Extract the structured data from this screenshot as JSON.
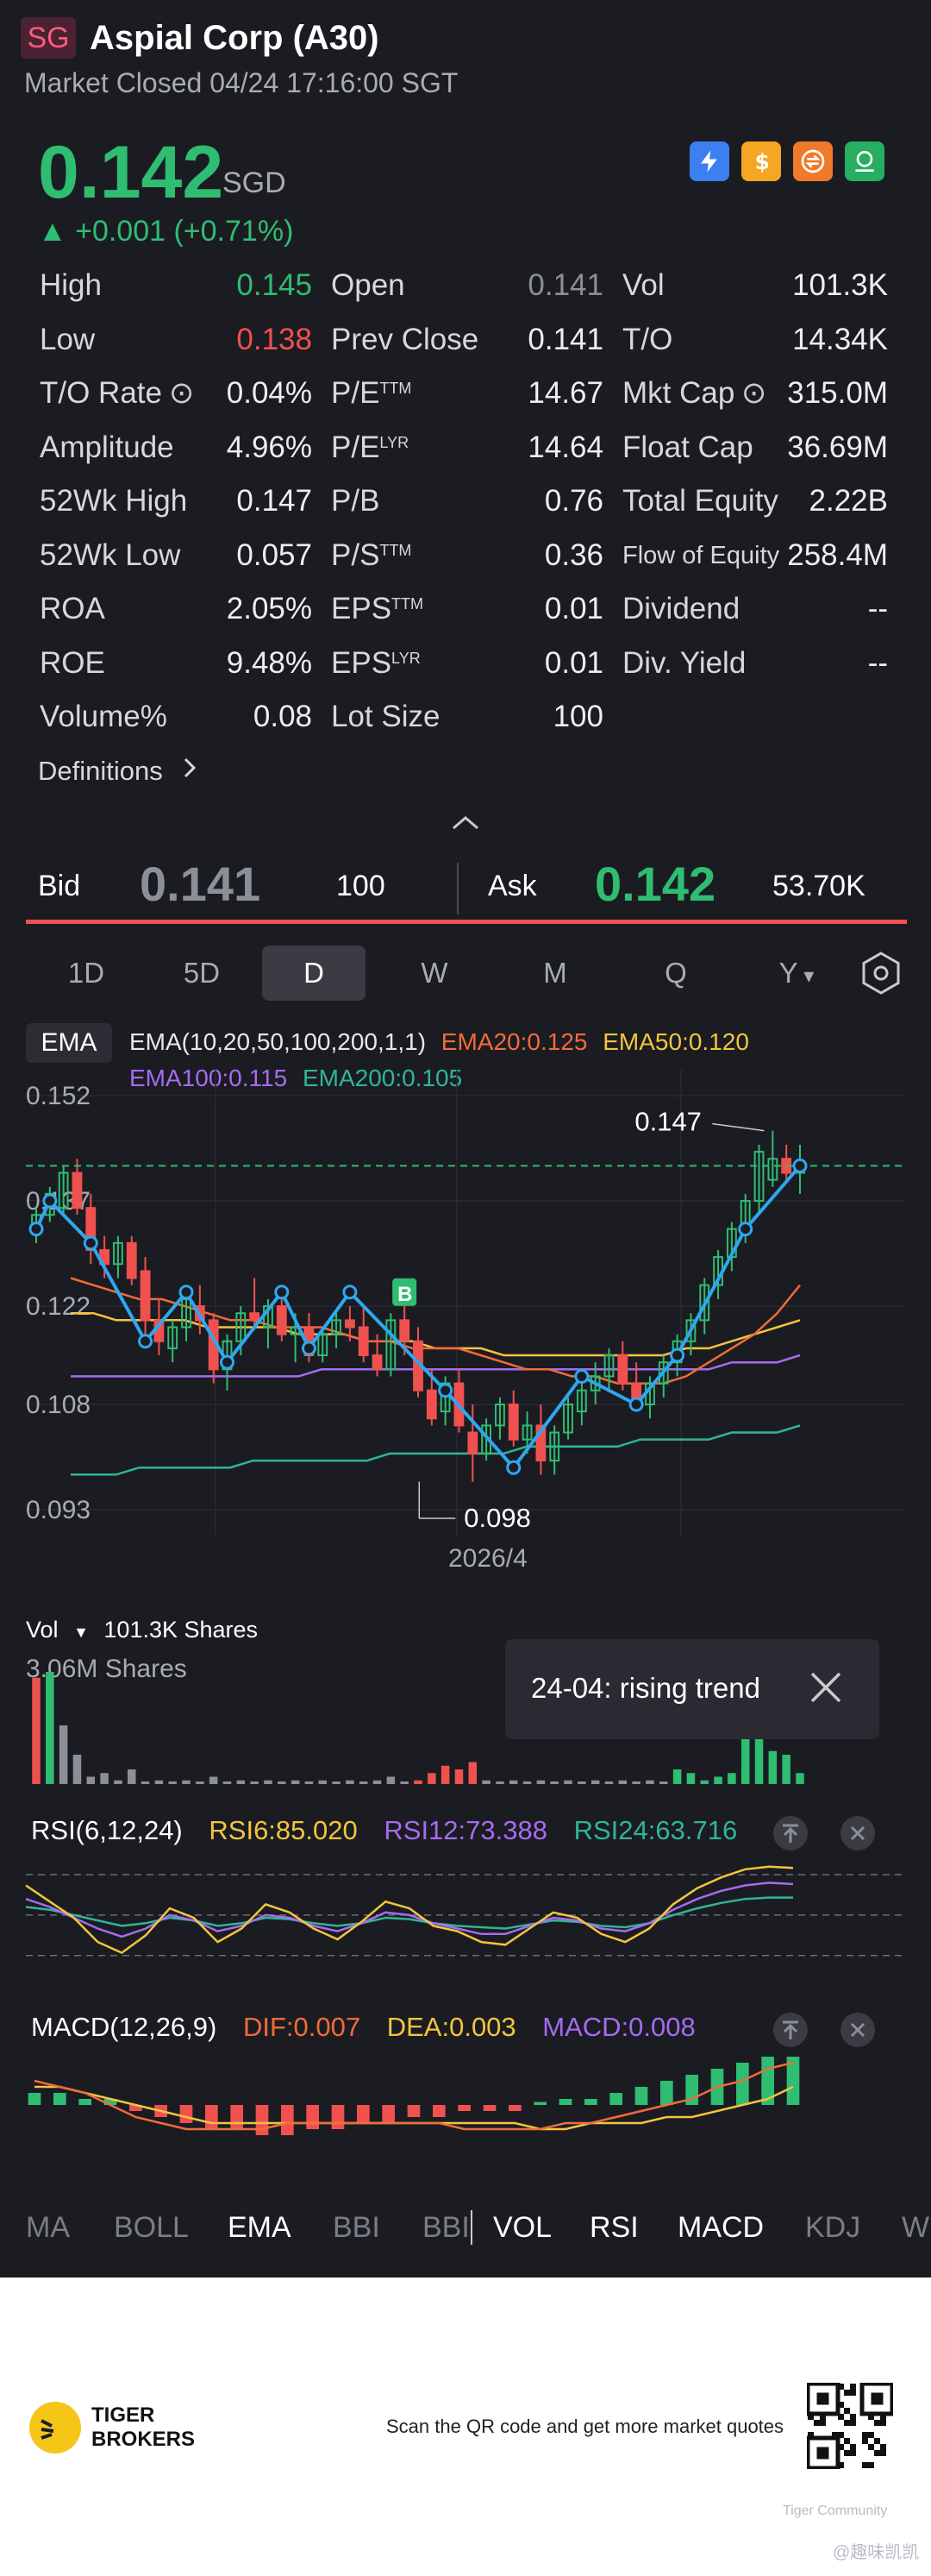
{
  "header": {
    "badge": "SG",
    "title": "Aspial Corp (A30)",
    "status": "Market Closed 04/24 17:16:00 SGT",
    "price": "0.142",
    "currency": "SGD",
    "change": "▲ +0.001 (+0.71%)",
    "icons": [
      "lightning-icon",
      "dollar-icon",
      "swap-icon",
      "exchange-icon"
    ]
  },
  "stats": {
    "col1": [
      {
        "label": "High",
        "value": "0.145",
        "color": "green"
      },
      {
        "label": "Low",
        "value": "0.138",
        "color": "red"
      },
      {
        "label": "T/O Rate",
        "value": "0.04%",
        "color": "white"
      },
      {
        "label": "Amplitude",
        "value": "4.96%",
        "color": "white"
      },
      {
        "label": "52Wk High",
        "value": "0.147",
        "color": "white"
      },
      {
        "label": "52Wk Low",
        "value": "0.057",
        "color": "white"
      },
      {
        "label": "ROA",
        "value": "2.05%",
        "color": "white"
      },
      {
        "label": "ROE",
        "value": "9.48%",
        "color": "white"
      },
      {
        "label": "Volume%",
        "value": "0.08",
        "color": "white"
      }
    ],
    "col2": [
      {
        "label": "Open",
        "sup": "",
        "value": "0.141",
        "color": "grey"
      },
      {
        "label": "Prev Close",
        "sup": "",
        "value": "0.141",
        "color": "white"
      },
      {
        "label": "P/E",
        "sup": "TTM",
        "value": "14.67",
        "color": "white"
      },
      {
        "label": "P/E",
        "sup": "LYR",
        "value": "14.64",
        "color": "white"
      },
      {
        "label": "P/B",
        "sup": "",
        "value": "0.76",
        "color": "white"
      },
      {
        "label": "P/S",
        "sup": "TTM",
        "value": "0.36",
        "color": "white"
      },
      {
        "label": "EPS",
        "sup": "TTM",
        "value": "0.01",
        "color": "white"
      },
      {
        "label": "EPS",
        "sup": "LYR",
        "value": "0.01",
        "color": "white"
      },
      {
        "label": "Lot Size",
        "sup": "",
        "value": "100",
        "color": "white"
      }
    ],
    "col3": [
      {
        "label": "Vol",
        "value": "101.3K"
      },
      {
        "label": "T/O",
        "value": "14.34K"
      },
      {
        "label": "Mkt Cap",
        "value": "315.0M"
      },
      {
        "label": "Float Cap",
        "value": "36.69M"
      },
      {
        "label": "Total Equity",
        "value": "2.22B"
      },
      {
        "label": "Flow of Equity",
        "value": "258.4M"
      },
      {
        "label": "Dividend",
        "value": "--"
      },
      {
        "label": "Div. Yield",
        "value": "--"
      }
    ],
    "definitions": "Definitions"
  },
  "quote": {
    "bid_label": "Bid",
    "bid_price": "0.141",
    "bid_size": "100",
    "ask_label": "Ask",
    "ask_price": "0.142",
    "ask_size": "53.70K"
  },
  "period_tabs": [
    "1D",
    "5D",
    "D",
    "W",
    "M",
    "Q",
    "Y"
  ],
  "active_period": "D",
  "ema": {
    "badge": "EMA",
    "params": "EMA(10,20,50,100,200,1,1)",
    "ema20": "EMA20:0.125",
    "ema50": "EMA50:0.120",
    "ema100": "EMA100:0.115",
    "ema200": "EMA200:0.105",
    "colors": {
      "ema20": "#f26b3a",
      "ema50": "#f2c53d",
      "ema100": "#a66bf0",
      "ema200": "#2fb59a",
      "zigzag": "#2ea7f0"
    }
  },
  "chart_data": {
    "type": "candlestick",
    "y_ticks": [
      "0.152",
      "0.137",
      "0.122",
      "0.108",
      "0.093"
    ],
    "x_label": "2026/4",
    "annotations": {
      "high": "0.147",
      "low": "0.098",
      "buy_marker": "B"
    },
    "ylim": [
      0.093,
      0.152
    ],
    "candles": [
      [
        0.133,
        0.136,
        0.131,
        0.135
      ],
      [
        0.135,
        0.139,
        0.134,
        0.138
      ],
      [
        0.136,
        0.142,
        0.135,
        0.141
      ],
      [
        0.141,
        0.143,
        0.135,
        0.136
      ],
      [
        0.136,
        0.138,
        0.128,
        0.13
      ],
      [
        0.13,
        0.132,
        0.126,
        0.128
      ],
      [
        0.128,
        0.132,
        0.126,
        0.131
      ],
      [
        0.131,
        0.132,
        0.125,
        0.126
      ],
      [
        0.127,
        0.129,
        0.118,
        0.12
      ],
      [
        0.12,
        0.123,
        0.115,
        0.117
      ],
      [
        0.116,
        0.12,
        0.114,
        0.119
      ],
      [
        0.119,
        0.124,
        0.117,
        0.123
      ],
      [
        0.122,
        0.125,
        0.118,
        0.12
      ],
      [
        0.12,
        0.121,
        0.111,
        0.113
      ],
      [
        0.113,
        0.118,
        0.11,
        0.117
      ],
      [
        0.117,
        0.122,
        0.115,
        0.121
      ],
      [
        0.121,
        0.126,
        0.119,
        0.12
      ],
      [
        0.119,
        0.123,
        0.116,
        0.122
      ],
      [
        0.122,
        0.123,
        0.117,
        0.118
      ],
      [
        0.118,
        0.121,
        0.114,
        0.119
      ],
      [
        0.119,
        0.121,
        0.114,
        0.115
      ],
      [
        0.115,
        0.119,
        0.114,
        0.118
      ],
      [
        0.118,
        0.121,
        0.116,
        0.12
      ],
      [
        0.12,
        0.122,
        0.117,
        0.119
      ],
      [
        0.119,
        0.122,
        0.114,
        0.115
      ],
      [
        0.115,
        0.118,
        0.112,
        0.113
      ],
      [
        0.113,
        0.121,
        0.112,
        0.12
      ],
      [
        0.12,
        0.122,
        0.115,
        0.117
      ],
      [
        0.117,
        0.119,
        0.109,
        0.11
      ],
      [
        0.11,
        0.113,
        0.105,
        0.106
      ],
      [
        0.107,
        0.112,
        0.105,
        0.111
      ],
      [
        0.111,
        0.113,
        0.104,
        0.105
      ],
      [
        0.104,
        0.108,
        0.097,
        0.101
      ],
      [
        0.101,
        0.106,
        0.1,
        0.105
      ],
      [
        0.105,
        0.109,
        0.103,
        0.108
      ],
      [
        0.108,
        0.11,
        0.102,
        0.103
      ],
      [
        0.103,
        0.107,
        0.101,
        0.105
      ],
      [
        0.105,
        0.108,
        0.098,
        0.1
      ],
      [
        0.1,
        0.105,
        0.098,
        0.104
      ],
      [
        0.104,
        0.109,
        0.103,
        0.108
      ],
      [
        0.107,
        0.111,
        0.105,
        0.11
      ],
      [
        0.11,
        0.114,
        0.108,
        0.112
      ],
      [
        0.112,
        0.116,
        0.11,
        0.115
      ],
      [
        0.115,
        0.117,
        0.11,
        0.111
      ],
      [
        0.111,
        0.114,
        0.108,
        0.108
      ],
      [
        0.108,
        0.112,
        0.106,
        0.111
      ],
      [
        0.111,
        0.115,
        0.109,
        0.114
      ],
      [
        0.114,
        0.118,
        0.112,
        0.117
      ],
      [
        0.117,
        0.121,
        0.115,
        0.12
      ],
      [
        0.12,
        0.126,
        0.118,
        0.125
      ],
      [
        0.125,
        0.13,
        0.123,
        0.129
      ],
      [
        0.129,
        0.134,
        0.127,
        0.133
      ],
      [
        0.133,
        0.138,
        0.131,
        0.137
      ],
      [
        0.137,
        0.145,
        0.135,
        0.144
      ],
      [
        0.14,
        0.147,
        0.139,
        0.143
      ],
      [
        0.143,
        0.145,
        0.14,
        0.141
      ],
      [
        0.141,
        0.145,
        0.138,
        0.142
      ]
    ],
    "ema20": [
      0.126,
      0.125,
      0.124,
      0.123,
      0.123,
      0.122,
      0.121,
      0.12,
      0.12,
      0.119,
      0.119,
      0.119,
      0.118,
      0.117,
      0.117,
      0.116,
      0.116,
      0.116,
      0.115,
      0.114,
      0.113,
      0.113,
      0.112,
      0.112,
      0.111,
      0.111,
      0.111,
      0.112,
      0.114,
      0.116,
      0.118,
      0.121,
      0.125
    ],
    "ema50": [
      0.121,
      0.121,
      0.12,
      0.12,
      0.12,
      0.12,
      0.119,
      0.119,
      0.119,
      0.119,
      0.118,
      0.118,
      0.118,
      0.117,
      0.117,
      0.117,
      0.116,
      0.116,
      0.116,
      0.115,
      0.115,
      0.115,
      0.115,
      0.115,
      0.115,
      0.115,
      0.115,
      0.116,
      0.116,
      0.117,
      0.118,
      0.119,
      0.12
    ],
    "ema100": [
      0.112,
      0.112,
      0.112,
      0.112,
      0.112,
      0.112,
      0.112,
      0.112,
      0.112,
      0.112,
      0.112,
      0.113,
      0.113,
      0.113,
      0.113,
      0.113,
      0.113,
      0.113,
      0.113,
      0.113,
      0.113,
      0.113,
      0.113,
      0.113,
      0.113,
      0.113,
      0.113,
      0.113,
      0.113,
      0.114,
      0.114,
      0.114,
      0.115
    ],
    "ema200": [
      0.098,
      0.098,
      0.098,
      0.099,
      0.099,
      0.099,
      0.099,
      0.099,
      0.1,
      0.1,
      0.1,
      0.1,
      0.1,
      0.1,
      0.101,
      0.101,
      0.101,
      0.101,
      0.101,
      0.101,
      0.102,
      0.102,
      0.102,
      0.102,
      0.102,
      0.103,
      0.103,
      0.103,
      0.103,
      0.104,
      0.104,
      0.104,
      0.105
    ],
    "zigzag": [
      [
        0,
        0.133
      ],
      [
        1,
        0.137
      ],
      [
        4,
        0.131
      ],
      [
        8,
        0.117
      ],
      [
        11,
        0.124
      ],
      [
        14,
        0.114
      ],
      [
        18,
        0.124
      ],
      [
        20,
        0.116
      ],
      [
        23,
        0.124
      ],
      [
        30,
        0.11
      ],
      [
        35,
        0.099
      ],
      [
        40,
        0.112
      ],
      [
        44,
        0.108
      ],
      [
        47,
        0.115
      ],
      [
        52,
        0.133
      ],
      [
        56,
        0.142
      ]
    ]
  },
  "volume": {
    "label": "Vol",
    "shares": "101.3K Shares",
    "scale": "3.06M Shares",
    "tooltip": "24-04: rising trend",
    "bars": [
      2.9,
      3.06,
      1.6,
      0.8,
      0.2,
      0.3,
      0.1,
      0.4,
      0.05,
      0.1,
      0.05,
      0.1,
      0.05,
      0.2,
      0.05,
      0.1,
      0.05,
      0.1,
      0.05,
      0.1,
      0.05,
      0.1,
      0.05,
      0.1,
      0.05,
      0.1,
      0.2,
      0.05,
      0.1,
      0.3,
      0.5,
      0.4,
      0.6,
      0.1,
      0.05,
      0.1,
      0.05,
      0.1,
      0.05,
      0.1,
      0.05,
      0.1,
      0.05,
      0.1,
      0.05,
      0.1,
      0.05,
      0.4,
      0.3,
      0.1,
      0.2,
      0.3,
      1.3,
      1.9,
      0.9,
      0.8,
      0.3
    ],
    "bar_colors": "rgdeeeeeeeeeeeeeeeeeeeeeeeeerrrrreeeeeeeeeeeeeegggggggggg"
  },
  "rsi": {
    "title": "RSI(6,12,24)",
    "rsi6": "RSI6:85.020",
    "rsi12": "RSI12:73.388",
    "rsi24": "RSI24:63.716",
    "series6": [
      72,
      60,
      48,
      30,
      22,
      35,
      55,
      48,
      30,
      40,
      58,
      52,
      40,
      32,
      45,
      60,
      55,
      42,
      38,
      30,
      28,
      40,
      52,
      48,
      36,
      30,
      40,
      58,
      70,
      78,
      84,
      86,
      85
    ],
    "series12": [
      62,
      56,
      48,
      40,
      34,
      40,
      50,
      46,
      38,
      42,
      50,
      48,
      42,
      38,
      44,
      52,
      50,
      44,
      40,
      36,
      36,
      42,
      48,
      46,
      40,
      38,
      44,
      54,
      62,
      68,
      72,
      74,
      73
    ],
    "series24": [
      56,
      54,
      50,
      46,
      42,
      44,
      48,
      46,
      42,
      44,
      48,
      47,
      44,
      42,
      44,
      48,
      47,
      44,
      42,
      41,
      40,
      43,
      46,
      45,
      42,
      41,
      44,
      50,
      55,
      59,
      62,
      63,
      63
    ]
  },
  "macd": {
    "title": "MACD(12,26,9)",
    "dif": "DIF:0.007",
    "dea": "DEA:0.003",
    "macd_val": "MACD:0.008",
    "hist": [
      0.002,
      0.002,
      0.001,
      0.001,
      -0.001,
      -0.002,
      -0.003,
      -0.004,
      -0.004,
      -0.005,
      -0.005,
      -0.004,
      -0.004,
      -0.003,
      -0.003,
      -0.002,
      -0.002,
      -0.001,
      -0.001,
      -0.001,
      0.0005,
      0.001,
      0.001,
      0.002,
      0.003,
      0.004,
      0.005,
      0.006,
      0.007,
      0.008,
      0.008
    ],
    "dif_series": [
      0.004,
      0.003,
      0.002,
      0.0,
      -0.002,
      -0.003,
      -0.004,
      -0.004,
      -0.004,
      -0.004,
      -0.003,
      -0.003,
      -0.003,
      -0.003,
      -0.003,
      -0.003,
      -0.003,
      -0.004,
      -0.004,
      -0.004,
      -0.004,
      -0.003,
      -0.003,
      -0.002,
      -0.001,
      0.0,
      0.001,
      0.003,
      0.004,
      0.006,
      0.007
    ],
    "dea_series": [
      0.003,
      0.003,
      0.002,
      0.001,
      0.0,
      -0.001,
      -0.002,
      -0.003,
      -0.003,
      -0.003,
      -0.003,
      -0.003,
      -0.003,
      -0.003,
      -0.003,
      -0.003,
      -0.003,
      -0.003,
      -0.003,
      -0.003,
      -0.004,
      -0.004,
      -0.003,
      -0.003,
      -0.003,
      -0.002,
      -0.002,
      -0.001,
      0.0,
      0.001,
      0.003
    ]
  },
  "indicator_tabs": [
    "MA",
    "BOLL",
    "EMA",
    "BBI",
    "BBI",
    "VOL",
    "RSI",
    "MACD",
    "KDJ",
    "W"
  ],
  "footer": {
    "brand_line1": "TIGER",
    "brand_line2": "BROKERS",
    "cta": "Scan the QR code and get more market quotes",
    "watermark": "Tiger Community",
    "handle": "@趣味凯凯"
  }
}
